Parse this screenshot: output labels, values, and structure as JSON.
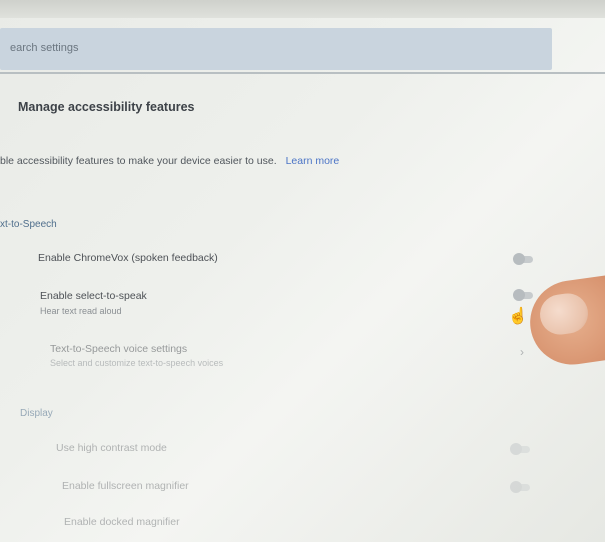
{
  "search": {
    "placeholder": "earch settings"
  },
  "section": {
    "title": "Manage accessibility features",
    "intro": "ble accessibility features to make your device easier to use.",
    "learn_more": "Learn more"
  },
  "tts": {
    "label": "xt-to-Speech",
    "rows": [
      {
        "label": "Enable ChromeVox (spoken feedback)"
      },
      {
        "label": "Enable select-to-speak",
        "sub": "Hear text read aloud"
      },
      {
        "label": "Text-to-Speech voice settings",
        "sub": "Select and customize text-to-speech voices"
      }
    ]
  },
  "display": {
    "label": "Display",
    "rows": [
      {
        "label": "Use high contrast mode"
      },
      {
        "label": "Enable fullscreen magnifier"
      },
      {
        "label": "Enable docked magnifier"
      }
    ]
  },
  "colors": {
    "accent": "#4b74c6",
    "search_bg": "#c9d4de"
  }
}
